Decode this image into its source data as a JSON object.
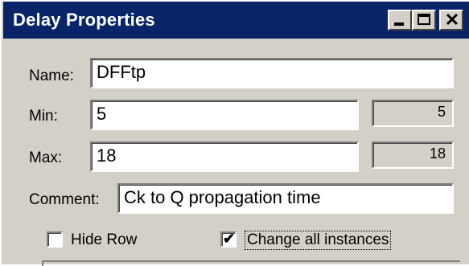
{
  "window": {
    "title": "Delay Properties",
    "controls": {
      "minimize_icon": "minimize-icon",
      "maximize_icon": "maximize-icon",
      "close_icon": "close-icon",
      "close_glyph": "✕"
    }
  },
  "form": {
    "name": {
      "label": "Name:",
      "value": "DFFtp"
    },
    "min": {
      "label": "Min:",
      "value": "5",
      "display": "5"
    },
    "max": {
      "label": "Max:",
      "value": "18",
      "display": "18"
    },
    "comment": {
      "label": "Comment:",
      "value": "Ck to Q propagation time"
    },
    "hide_row": {
      "label": "Hide Row",
      "checked": false
    },
    "change_all": {
      "label": "Change all instances",
      "checked": true,
      "mark": "✔"
    }
  },
  "colors": {
    "titlebar": "#0a246a",
    "face": "#d4d0c8"
  }
}
